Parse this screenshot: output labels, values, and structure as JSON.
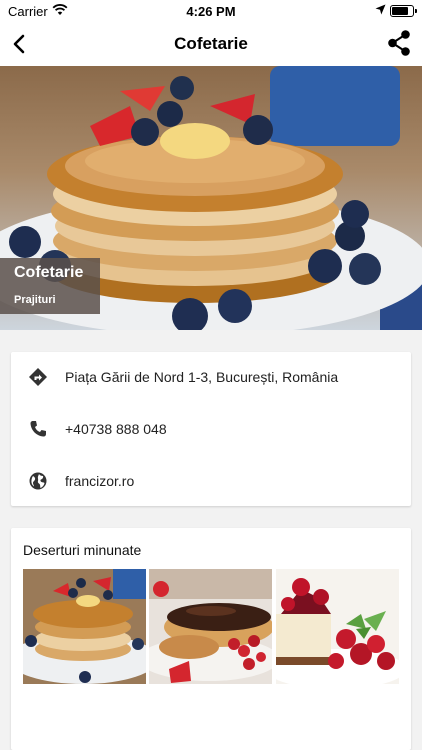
{
  "status": {
    "carrier": "Carrier",
    "time": "4:26 PM",
    "battery_level": 0.85
  },
  "nav": {
    "title": "Cofetarie"
  },
  "hero": {
    "name": "Cofetarie",
    "category": "Prajituri"
  },
  "info": {
    "address": "Piața Gării de Nord 1-3, București, România",
    "phone": "+40738 888 048",
    "website": "francizor.ro"
  },
  "gallery": {
    "title": "Deserturi minunate",
    "items": [
      "pancakes",
      "eclair",
      "cheesecake"
    ]
  },
  "colors": {
    "overlay": "#5a504b",
    "icon": "#333333",
    "background": "#f2f2f2"
  }
}
